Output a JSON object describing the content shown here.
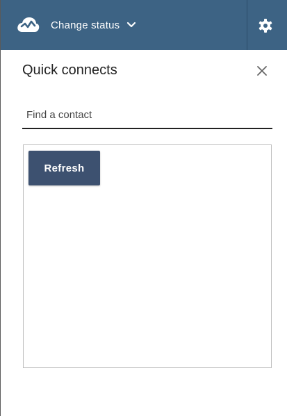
{
  "header": {
    "status_label": "Change status",
    "icons": {
      "logo": "cloud-connect-icon",
      "dropdown": "chevron-down-icon",
      "settings": "gear-icon"
    },
    "colors": {
      "bar": "#3d6384",
      "text": "#ffffff"
    }
  },
  "panel": {
    "title": "Quick connects",
    "close_icon": "close-icon",
    "search": {
      "placeholder": "Find a contact",
      "value": ""
    },
    "refresh_label": "Refresh",
    "colors": {
      "button": "#3d5170"
    }
  }
}
